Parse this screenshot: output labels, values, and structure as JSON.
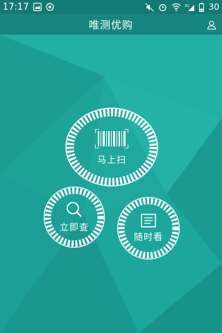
{
  "status_bar": {
    "time": "17:17",
    "battery": "30",
    "network": "3G"
  },
  "app_bar": {
    "title": "唯测优购",
    "user_icon": "user-icon"
  },
  "actions": {
    "scan": {
      "label": "马上扫",
      "icon": "barcode-icon"
    },
    "search": {
      "label": "立即查",
      "icon": "search-icon"
    },
    "view": {
      "label": "随时看",
      "icon": "document-icon"
    }
  },
  "colors": {
    "background": "#1fa89e",
    "status_bar": "#127a73",
    "app_bar": "#16867e"
  }
}
